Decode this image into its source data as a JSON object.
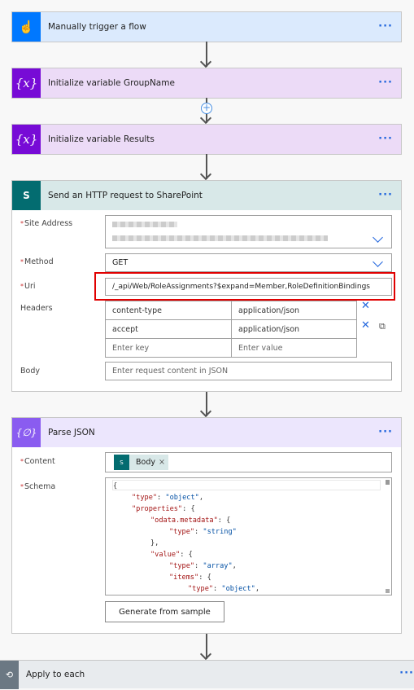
{
  "steps": [
    {
      "title": "Manually trigger a flow",
      "icon": "touch-hand-icon",
      "color": "#0078ff",
      "header_bg": "#dbeafd"
    },
    {
      "title": "Initialize variable GroupName",
      "icon": "variable-icon",
      "color": "#770bd6",
      "header_bg": "#ecdbf7"
    },
    {
      "title": "Initialize variable Results",
      "icon": "variable-icon",
      "color": "#770bd6",
      "header_bg": "#ecdbf7"
    },
    {
      "title": "Send an HTTP request to SharePoint",
      "icon": "sharepoint-icon",
      "color": "#036c70",
      "header_bg": "#d8e8e8"
    },
    {
      "title": "Parse JSON",
      "icon": "parse-json-icon",
      "color": "#8a5cf0",
      "header_bg": "#ece6fd"
    },
    {
      "title": "Apply to each",
      "icon": "loop-icon",
      "color": "#6b7883",
      "header_bg": "#e8ebee"
    }
  ],
  "more_label": "···",
  "http": {
    "site_address_label": "Site Address",
    "method_label": "Method",
    "method_value": "GET",
    "uri_label": "Uri",
    "uri_value": "/_api/Web/RoleAssignments?$expand=Member,RoleDefinitionBindings",
    "headers_label": "Headers",
    "headers": [
      {
        "key": "content-type",
        "value": "application/json"
      },
      {
        "key": "accept",
        "value": "application/json"
      }
    ],
    "key_placeholder": "Enter key",
    "value_placeholder": "Enter value",
    "body_label": "Body",
    "body_placeholder": "Enter request content in JSON"
  },
  "parse": {
    "content_label": "Content",
    "content_token": "Body",
    "schema_label": "Schema",
    "schema_lines": [
      {
        "indent": 0,
        "parts": [
          [
            "p",
            "{"
          ]
        ]
      },
      {
        "indent": 1,
        "parts": [
          [
            "k",
            "\"type\""
          ],
          [
            "p",
            ": "
          ],
          [
            "s",
            "\"object\""
          ],
          [
            "p",
            ","
          ]
        ]
      },
      {
        "indent": 1,
        "parts": [
          [
            "k",
            "\"properties\""
          ],
          [
            "p",
            ": {"
          ]
        ]
      },
      {
        "indent": 2,
        "parts": [
          [
            "k",
            "\"odata.metadata\""
          ],
          [
            "p",
            ": {"
          ]
        ]
      },
      {
        "indent": 3,
        "parts": [
          [
            "k",
            "\"type\""
          ],
          [
            "p",
            ": "
          ],
          [
            "s",
            "\"string\""
          ]
        ]
      },
      {
        "indent": 2,
        "parts": [
          [
            "p",
            "},"
          ]
        ]
      },
      {
        "indent": 2,
        "parts": [
          [
            "k",
            "\"value\""
          ],
          [
            "p",
            ": {"
          ]
        ]
      },
      {
        "indent": 3,
        "parts": [
          [
            "k",
            "\"type\""
          ],
          [
            "p",
            ": "
          ],
          [
            "s",
            "\"array\""
          ],
          [
            "p",
            ","
          ]
        ]
      },
      {
        "indent": 3,
        "parts": [
          [
            "k",
            "\"items\""
          ],
          [
            "p",
            ": {"
          ]
        ]
      },
      {
        "indent": 4,
        "parts": [
          [
            "k",
            "\"type\""
          ],
          [
            "p",
            ": "
          ],
          [
            "s",
            "\"object\""
          ],
          [
            "p",
            ","
          ]
        ]
      }
    ],
    "generate_label": "Generate from sample"
  },
  "highlight_color": "#e00000"
}
